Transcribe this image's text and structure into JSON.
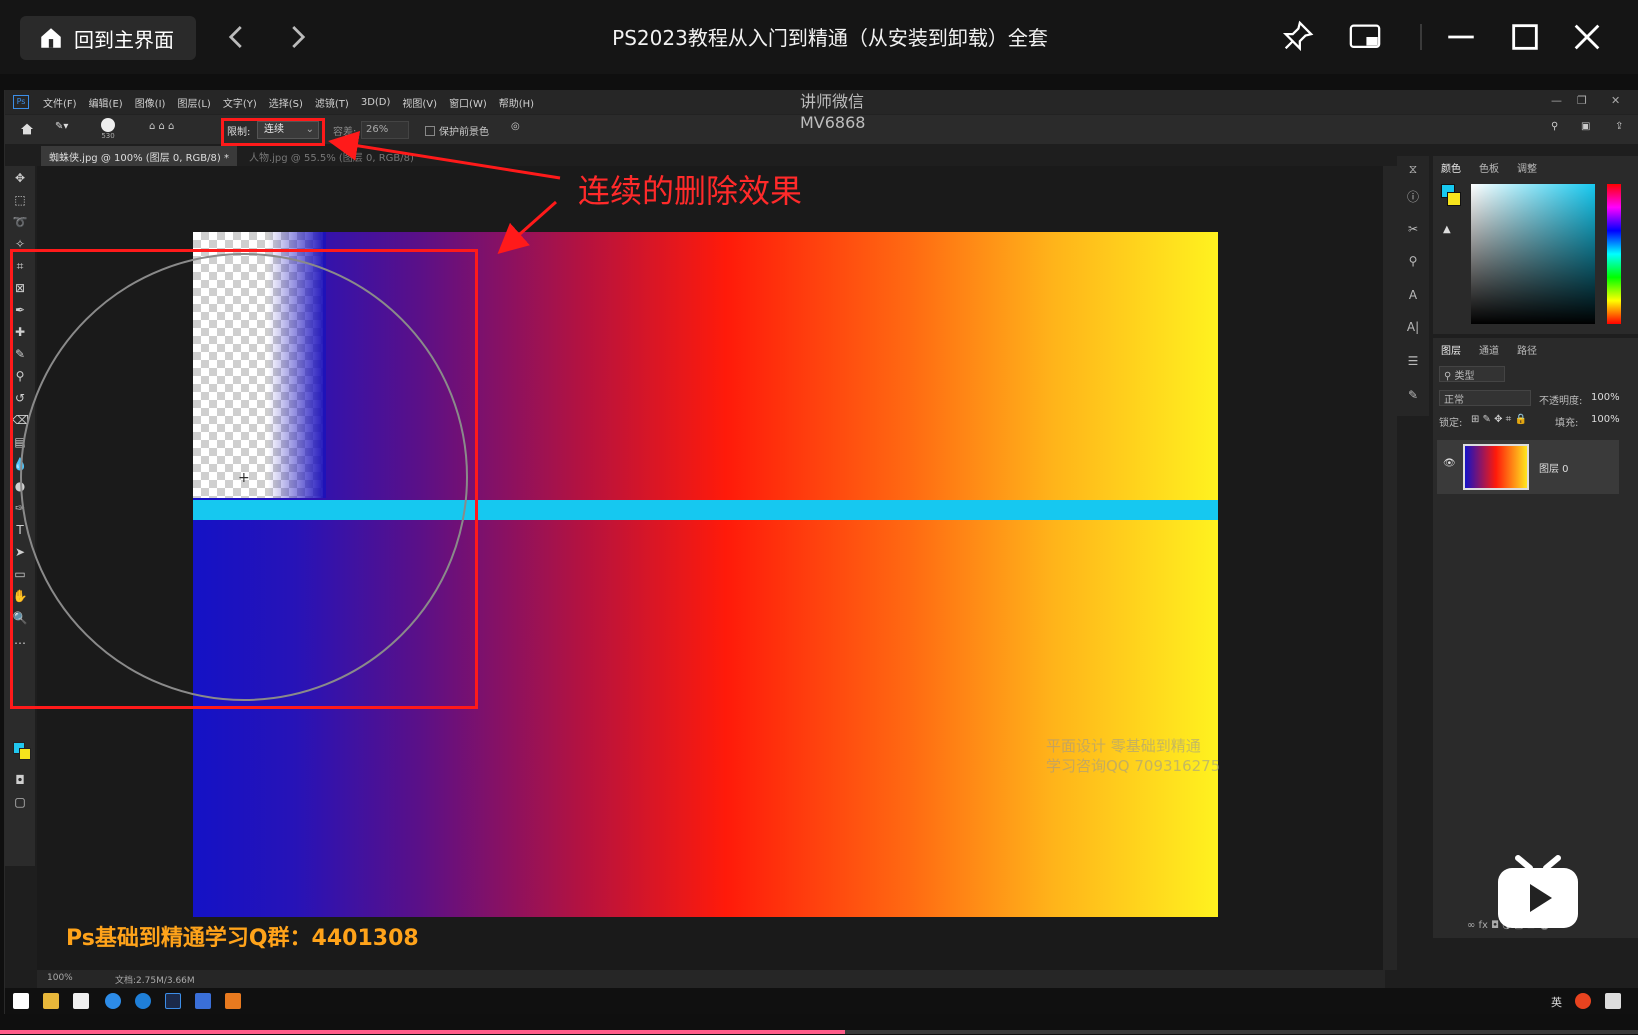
{
  "player": {
    "home_label": "回到主界面",
    "title": "PS2023教程从入门到精通（从安装到卸载）全套",
    "progress": 0.516
  },
  "ps": {
    "menu": [
      "文件(F)",
      "编辑(E)",
      "图像(I)",
      "图层(L)",
      "文字(Y)",
      "选择(S)",
      "滤镜(T)",
      "3D(D)",
      "视图(V)",
      "窗口(W)",
      "帮助(H)"
    ],
    "logo": "Ps",
    "watermark_line1": "讲师微信",
    "watermark_line2": "MV6868",
    "options": {
      "limit_label": "限制:",
      "limit_value": "连续",
      "tolerance_label": "容差:",
      "tolerance_value": "26%",
      "protect_label": "保护前景色",
      "brush_size": "530"
    },
    "tabs": [
      "蜘蛛侠.jpg @ 100% (图层 0, RGB/8) *",
      "人物.jpg @ 55.5% (图层 0, RGB/8)"
    ],
    "status": {
      "zoom": "100%",
      "doc": "文档:2.75M/3.66M"
    },
    "canvas_watermark_line1": "平面设计  零基础到精通",
    "canvas_watermark_line2": "学习咨询QQ 709316275",
    "qq_group": "Ps基础到精通学习Q群：4401308",
    "annotation": "连续的删除效果",
    "color_panel_tabs": [
      "颜色",
      "色板",
      "调整"
    ],
    "layers_panel_tabs": [
      "图层",
      "通道",
      "路径"
    ],
    "layers": {
      "filter": "类型",
      "blend_mode": "正常",
      "opacity_label": "不透明度:",
      "opacity_value": "100%",
      "lock_label": "锁定:",
      "fill_label": "填充:",
      "fill_value": "100%",
      "layer_name": "图层 0"
    },
    "taskbar_lang": "英"
  }
}
